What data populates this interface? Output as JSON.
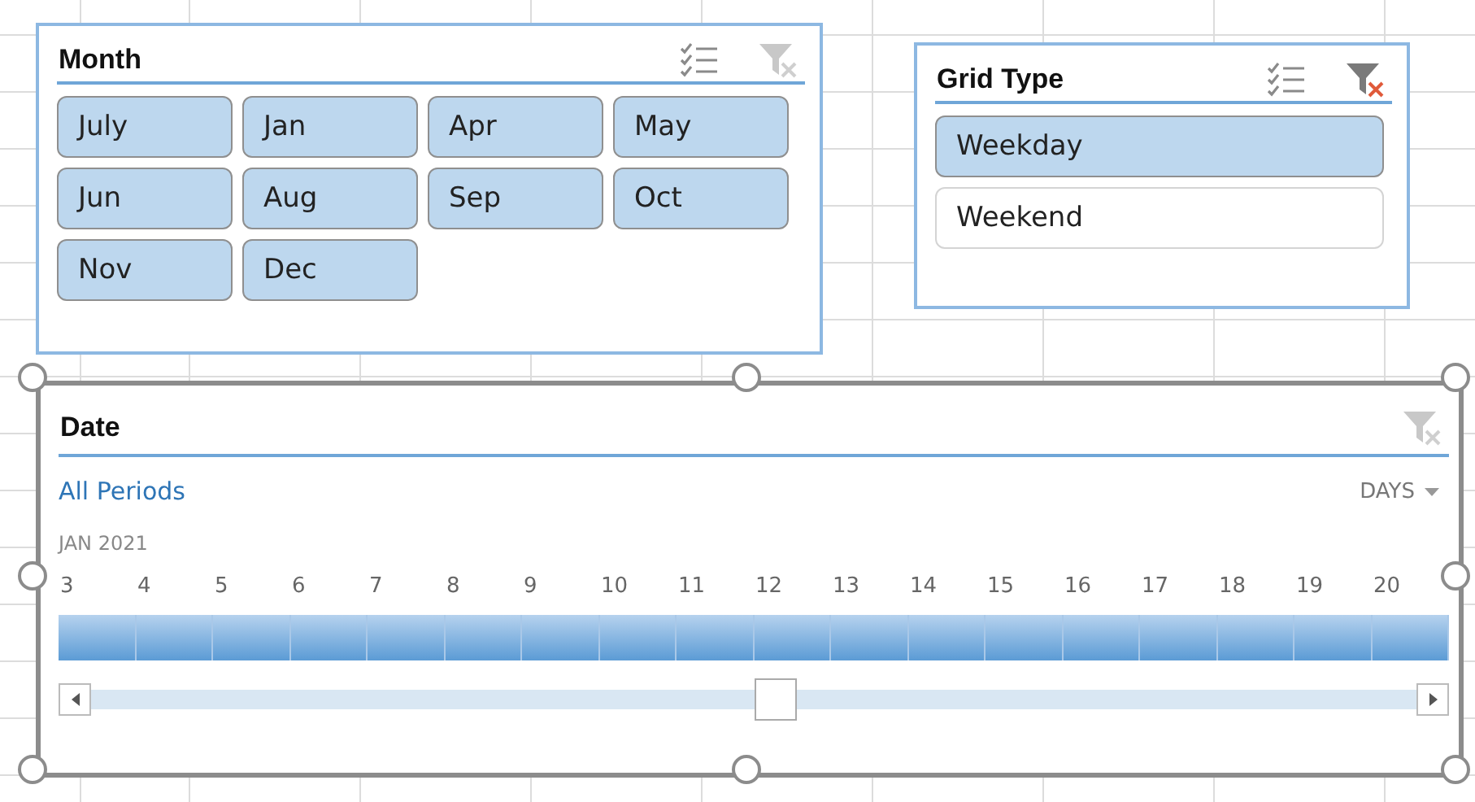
{
  "slicers": [
    {
      "title": "Month",
      "kind": "tiles",
      "items": [
        {
          "label": "July",
          "selected": true
        },
        {
          "label": "Jan",
          "selected": true
        },
        {
          "label": "Apr",
          "selected": true
        },
        {
          "label": "May",
          "selected": true
        },
        {
          "label": "Jun",
          "selected": true
        },
        {
          "label": "Aug",
          "selected": true
        },
        {
          "label": "Sep",
          "selected": true
        },
        {
          "label": "Oct",
          "selected": true
        },
        {
          "label": "Nov",
          "selected": true
        },
        {
          "label": "Dec",
          "selected": true
        }
      ]
    },
    {
      "title": "Grid Type",
      "kind": "list",
      "items": [
        {
          "label": "Weekday",
          "selected": true
        },
        {
          "label": "Weekend",
          "selected": false
        }
      ]
    }
  ],
  "timeline": {
    "title": "Date",
    "selected": true,
    "period_label": "All Periods",
    "level_label": "DAYS",
    "month_label": "JAN 2021",
    "days": [
      {
        "label": "3",
        "selected": true
      },
      {
        "label": "4",
        "selected": true
      },
      {
        "label": "5",
        "selected": true
      },
      {
        "label": "6",
        "selected": true
      },
      {
        "label": "7",
        "selected": true
      },
      {
        "label": "8",
        "selected": true
      },
      {
        "label": "9",
        "selected": true
      },
      {
        "label": "10",
        "selected": true
      },
      {
        "label": "11",
        "selected": true
      },
      {
        "label": "12",
        "selected": true
      },
      {
        "label": "13",
        "selected": true
      },
      {
        "label": "14",
        "selected": true
      },
      {
        "label": "15",
        "selected": true
      },
      {
        "label": "16",
        "selected": true
      },
      {
        "label": "17",
        "selected": true
      },
      {
        "label": "18",
        "selected": true
      },
      {
        "label": "19",
        "selected": true
      },
      {
        "label": "20",
        "selected": true
      }
    ]
  }
}
